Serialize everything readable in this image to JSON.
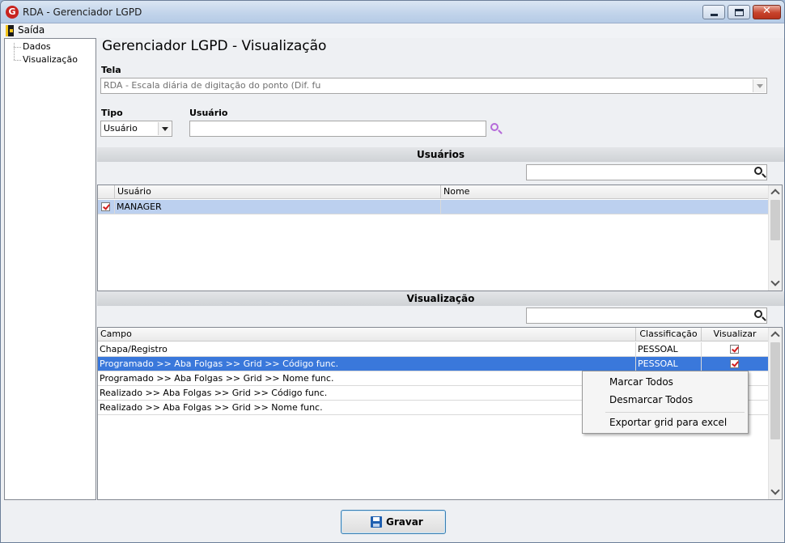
{
  "window": {
    "title": "RDA - Gerenciador LGPD",
    "logo_letter": "G",
    "close_glyph": "✕"
  },
  "menu": {
    "exit_label": "Saída"
  },
  "tree": {
    "items": [
      "Dados",
      "Visualização"
    ]
  },
  "page": {
    "title": "Gerenciador LGPD - Visualização"
  },
  "form": {
    "tela_label": "Tela",
    "tela_value": "RDA - Escala diária de digitação do ponto (Dif. fu",
    "tipo_label": "Tipo",
    "tipo_value": "Usuário",
    "usuario_label": "Usuário",
    "usuario_value": ""
  },
  "users_section": {
    "title": "Usuários",
    "filter_value": "",
    "columns": [
      "Usuário",
      "Nome"
    ],
    "rows": [
      {
        "checked": true,
        "usuario": "MANAGER",
        "nome": ""
      }
    ]
  },
  "view_section": {
    "title": "Visualização",
    "filter_value": "",
    "columns": [
      "Campo",
      "Classificação",
      "Visualizar"
    ],
    "rows": [
      {
        "campo": "Chapa/Registro",
        "classificacao": "PESSOAL",
        "visualizar": true
      },
      {
        "campo": "Programado >> Aba Folgas >> Grid >> Código func.",
        "classificacao": "PESSOAL",
        "visualizar": true
      },
      {
        "campo": "Programado >> Aba Folgas >> Grid >> Nome func.",
        "classificacao": "",
        "visualizar": false
      },
      {
        "campo": "Realizado >> Aba Folgas >> Grid >> Código func.",
        "classificacao": "",
        "visualizar": false
      },
      {
        "campo": "Realizado >> Aba Folgas >> Grid >> Nome func.",
        "classificacao": "",
        "visualizar": false
      }
    ]
  },
  "context_menu": {
    "items": [
      "Marcar Todos",
      "Desmarcar Todos",
      "Exportar grid para excel"
    ]
  },
  "footer": {
    "save_label": "Gravar"
  }
}
